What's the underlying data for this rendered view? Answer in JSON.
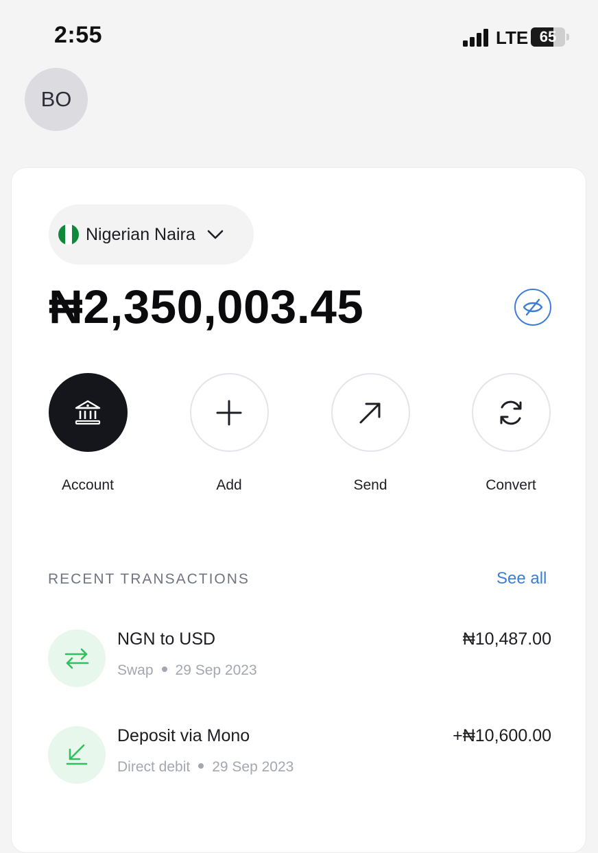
{
  "status_bar": {
    "time": "2:55",
    "network": "LTE",
    "battery_level": "65"
  },
  "profile": {
    "initials": "BO"
  },
  "wallet": {
    "currency_name": "Nigerian Naira",
    "balance": "₦2,350,003.45"
  },
  "actions": [
    {
      "label": "Account",
      "icon": "bank-icon"
    },
    {
      "label": "Add",
      "icon": "plus-icon"
    },
    {
      "label": "Send",
      "icon": "arrow-up-right-icon"
    },
    {
      "label": "Convert",
      "icon": "refresh-icon"
    }
  ],
  "transactions_section": {
    "title": "RECENT TRANSACTIONS",
    "see_all": "See all"
  },
  "transactions": [
    {
      "title": "NGN to USD",
      "type": "Swap",
      "date": "29 Sep 2023",
      "amount": "₦10,487.00",
      "icon": "swap-arrows-icon"
    },
    {
      "title": "Deposit via Mono",
      "type": "Direct debit",
      "date": "29 Sep 2023",
      "amount": "+₦10,600.00",
      "icon": "arrow-down-left-icon"
    }
  ],
  "colors": {
    "accent_blue": "#3a7fd5",
    "icon_green": "#2fbf5f",
    "dark_button": "#15161c"
  }
}
